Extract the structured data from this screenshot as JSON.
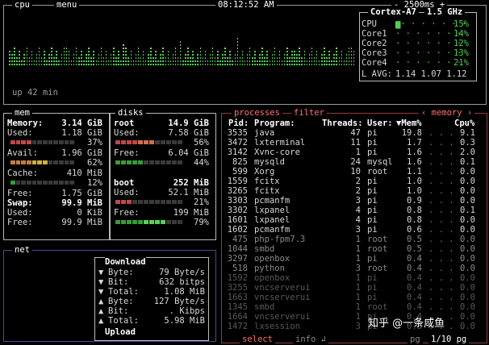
{
  "top": {
    "tag_cpu": "cpu",
    "tag_menu": "menu",
    "clock": "08:12:52 AM",
    "interval": "- 2500ms +",
    "uptime": "up 42 min"
  },
  "cpu_panel": {
    "model": "Cortex-A7",
    "freq": "1.5 GHz",
    "rows": [
      {
        "label": "CPU",
        "pct": "15%"
      },
      {
        "label": "Core1",
        "pct": "14%"
      },
      {
        "label": "Core2",
        "pct": "12%"
      },
      {
        "label": "Core3",
        "pct": "13%"
      },
      {
        "label": "Core4",
        "pct": "21%"
      }
    ],
    "lavg_label": "L AVG:",
    "lavg": "1.14 1.07 1.12"
  },
  "mem": {
    "title": "mem",
    "memory_label": "Memory:",
    "memory_val": "3.14 GiB",
    "used_label": "Used:",
    "used_val": "1.18 GiB",
    "used_pct": "37%",
    "used_frac": 0.37,
    "avail_label": "Avail:",
    "avail_val": "1.96 GiB",
    "avail_pct": "62%",
    "avail_frac": 0.62,
    "cache_label": "Cache:",
    "cache_val": "410 MiB",
    "cache_pct": "12%",
    "cache_frac": 0.12,
    "free_label": "Free:",
    "free_val": "1.75 GiB",
    "swap_label": "Swap:",
    "swap_val": "99.9 MiB",
    "swap_used_label": "Used:",
    "swap_used_val": "0 KiB",
    "swap_free_label": "Free:",
    "swap_free_val": "99.9 MiB"
  },
  "disks": {
    "title": "disks",
    "d1_name": "root",
    "d1_size": "14.9 GiB",
    "d1_used_label": "Used:",
    "d1_used_val": "7.58 GiB",
    "d1_used_pct": "56%",
    "d1_used_frac": 0.56,
    "d1_free_label": "Free:",
    "d1_free_val": "6.04 GiB",
    "d1_free_pct": "44%",
    "d1_free_frac": 0.44,
    "d2_name": "boot",
    "d2_size": "252 MiB",
    "d2_used_label": "Used:",
    "d2_used_val": "52.1 MiB",
    "d2_used_pct": "21%",
    "d2_used_frac": 0.21,
    "d2_free_label": "Free:",
    "d2_free_val": "199 MiB",
    "d2_free_pct": "79%",
    "d2_free_frac": 0.79
  },
  "net": {
    "title": "net",
    "download": "Download",
    "upload": "Upload",
    "rows": [
      {
        "arrow": "▼",
        "label": "Byte:",
        "val": "79 Byte/s"
      },
      {
        "arrow": "▼",
        "label": "Bit:",
        "val": "632 bitps"
      },
      {
        "arrow": "▼",
        "label": "Total:",
        "val": "1.08 MiB"
      },
      {
        "arrow": "▲",
        "label": "Byte:",
        "val": "127 Byte/s"
      },
      {
        "arrow": "▲",
        "label": "Bit:",
        "val": ". Kibps"
      },
      {
        "arrow": "▲",
        "label": "Total:",
        "val": "5.98 MiB"
      }
    ]
  },
  "processes": {
    "title": "processes",
    "filter": "filter",
    "sort_tag": "‹ memory ›",
    "headers": {
      "pid": "Pid:",
      "program": "Program:",
      "threads": "Threads:",
      "user": "User:",
      "mem": "▼Mem%",
      "cpu": "Cpu%"
    },
    "rows": [
      {
        "pid": "3535",
        "program": "java",
        "threads": "47",
        "user": "pi",
        "mem": "19.8",
        "cpu": "9.1"
      },
      {
        "pid": "3472",
        "program": "lxterminal",
        "threads": "11",
        "user": "pi",
        "mem": "1.7",
        "cpu": "0.3"
      },
      {
        "pid": "3142",
        "program": "Xvnc-core",
        "threads": "1",
        "user": "pi",
        "mem": "1.6",
        "cpu": "2.0"
      },
      {
        "pid": "825",
        "program": "mysqld",
        "threads": "24",
        "user": "mysql",
        "mem": "1.6",
        "cpu": "0.1"
      },
      {
        "pid": "599",
        "program": "Xorg",
        "threads": "10",
        "user": "root",
        "mem": "1.1",
        "cpu": "0.0"
      },
      {
        "pid": "1559",
        "program": "fcitx",
        "threads": "2",
        "user": "pi",
        "mem": "1.0",
        "cpu": "0.0"
      },
      {
        "pid": "3265",
        "program": "fcitx",
        "threads": "2",
        "user": "pi",
        "mem": "1.0",
        "cpu": "0.0"
      },
      {
        "pid": "3303",
        "program": "pcmanfm",
        "threads": "3",
        "user": "pi",
        "mem": "0.9",
        "cpu": "0.0"
      },
      {
        "pid": "3302",
        "program": "lxpanel",
        "threads": "4",
        "user": "pi",
        "mem": "0.8",
        "cpu": "0.1"
      },
      {
        "pid": "1601",
        "program": "lxpanel",
        "threads": "4",
        "user": "pi",
        "mem": "0.8",
        "cpu": "0.0"
      },
      {
        "pid": "1602",
        "program": "pcmanfm",
        "threads": "3",
        "user": "pi",
        "mem": "0.6",
        "cpu": "0.0"
      },
      {
        "pid": "475",
        "program": "php-fpm7.3",
        "threads": "1",
        "user": "root",
        "mem": "0.5",
        "cpu": "0.0"
      },
      {
        "pid": "1044",
        "program": "smbd",
        "threads": "1",
        "user": "root",
        "mem": "0.5",
        "cpu": "0.0"
      },
      {
        "pid": "3297",
        "program": "openbox",
        "threads": "1",
        "user": "pi",
        "mem": "0.4",
        "cpu": "0.0"
      },
      {
        "pid": "518",
        "program": "python",
        "threads": "3",
        "user": "root",
        "mem": "0.4",
        "cpu": "0.0"
      },
      {
        "pid": "1592",
        "program": "openbox",
        "threads": "1",
        "user": "pi",
        "mem": "0.4",
        "cpu": "0.0"
      },
      {
        "pid": "3255",
        "program": "vncserverui",
        "threads": "1",
        "user": "pi",
        "mem": "0.4",
        "cpu": "0.0"
      },
      {
        "pid": "1663",
        "program": "vncserverui",
        "threads": "1",
        "user": "pi",
        "mem": "0.4",
        "cpu": "0.0"
      },
      {
        "pid": "1345",
        "program": "smbd",
        "threads": "1",
        "user": "root",
        "mem": "0.4",
        "cpu": "0.0"
      },
      {
        "pid": "1664",
        "program": "vncserverui",
        "threads": "1",
        "user": "pi",
        "mem": "0.4",
        "cpu": "0.0"
      },
      {
        "pid": "1472",
        "program": "lxsession",
        "threads": "3",
        "user": "pi",
        "mem": "0.3",
        "cpu": "0.0"
      }
    ],
    "select": "select",
    "info": "info ↲",
    "pg": "pg",
    "page": "1/10 pg"
  },
  "watermark": "知乎 @一条咸鱼",
  "colors": {
    "green": "#4fd04f",
    "red": "#d04a4a",
    "yellow": "#d0c040",
    "border": "#9a9a9a"
  }
}
